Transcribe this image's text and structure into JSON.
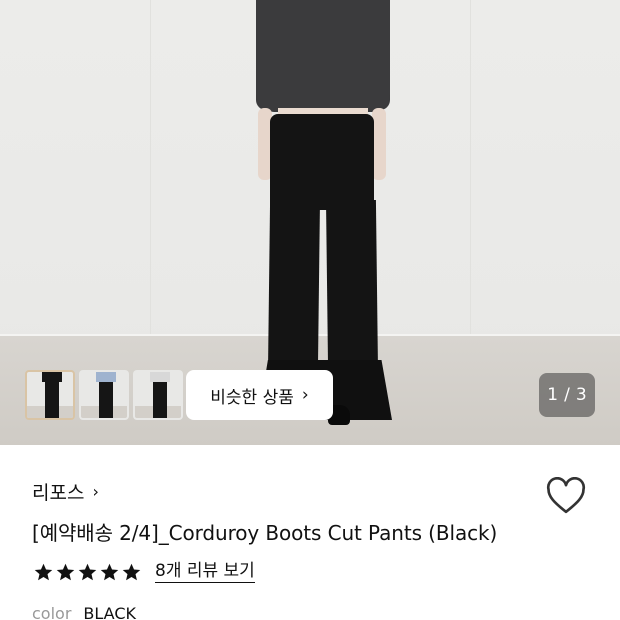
{
  "gallery": {
    "similar_button_label": "비슷한 상품",
    "pager": {
      "current": "1",
      "separator": "/",
      "total": "3"
    },
    "thumbnails": [
      {
        "name": "thumbnail-1",
        "active": true,
        "top_color": "#151515"
      },
      {
        "name": "thumbnail-2",
        "active": false,
        "top_color": "#9fb3cf"
      },
      {
        "name": "thumbnail-3",
        "active": false,
        "top_color": "#d8d8d8"
      }
    ]
  },
  "product": {
    "brand": "리포스",
    "title": "[예약배송 2/4]_Corduroy Boots Cut Pants (Black)",
    "rating": {
      "stars": 5,
      "review_link": "8개 리뷰 보기"
    },
    "color_label": "color",
    "color_value": "BLACK"
  },
  "colors": {
    "star": "#111111",
    "active_thumb_border": "#d9c4a5",
    "pager_bg": "rgba(60,60,60,0.55)"
  }
}
